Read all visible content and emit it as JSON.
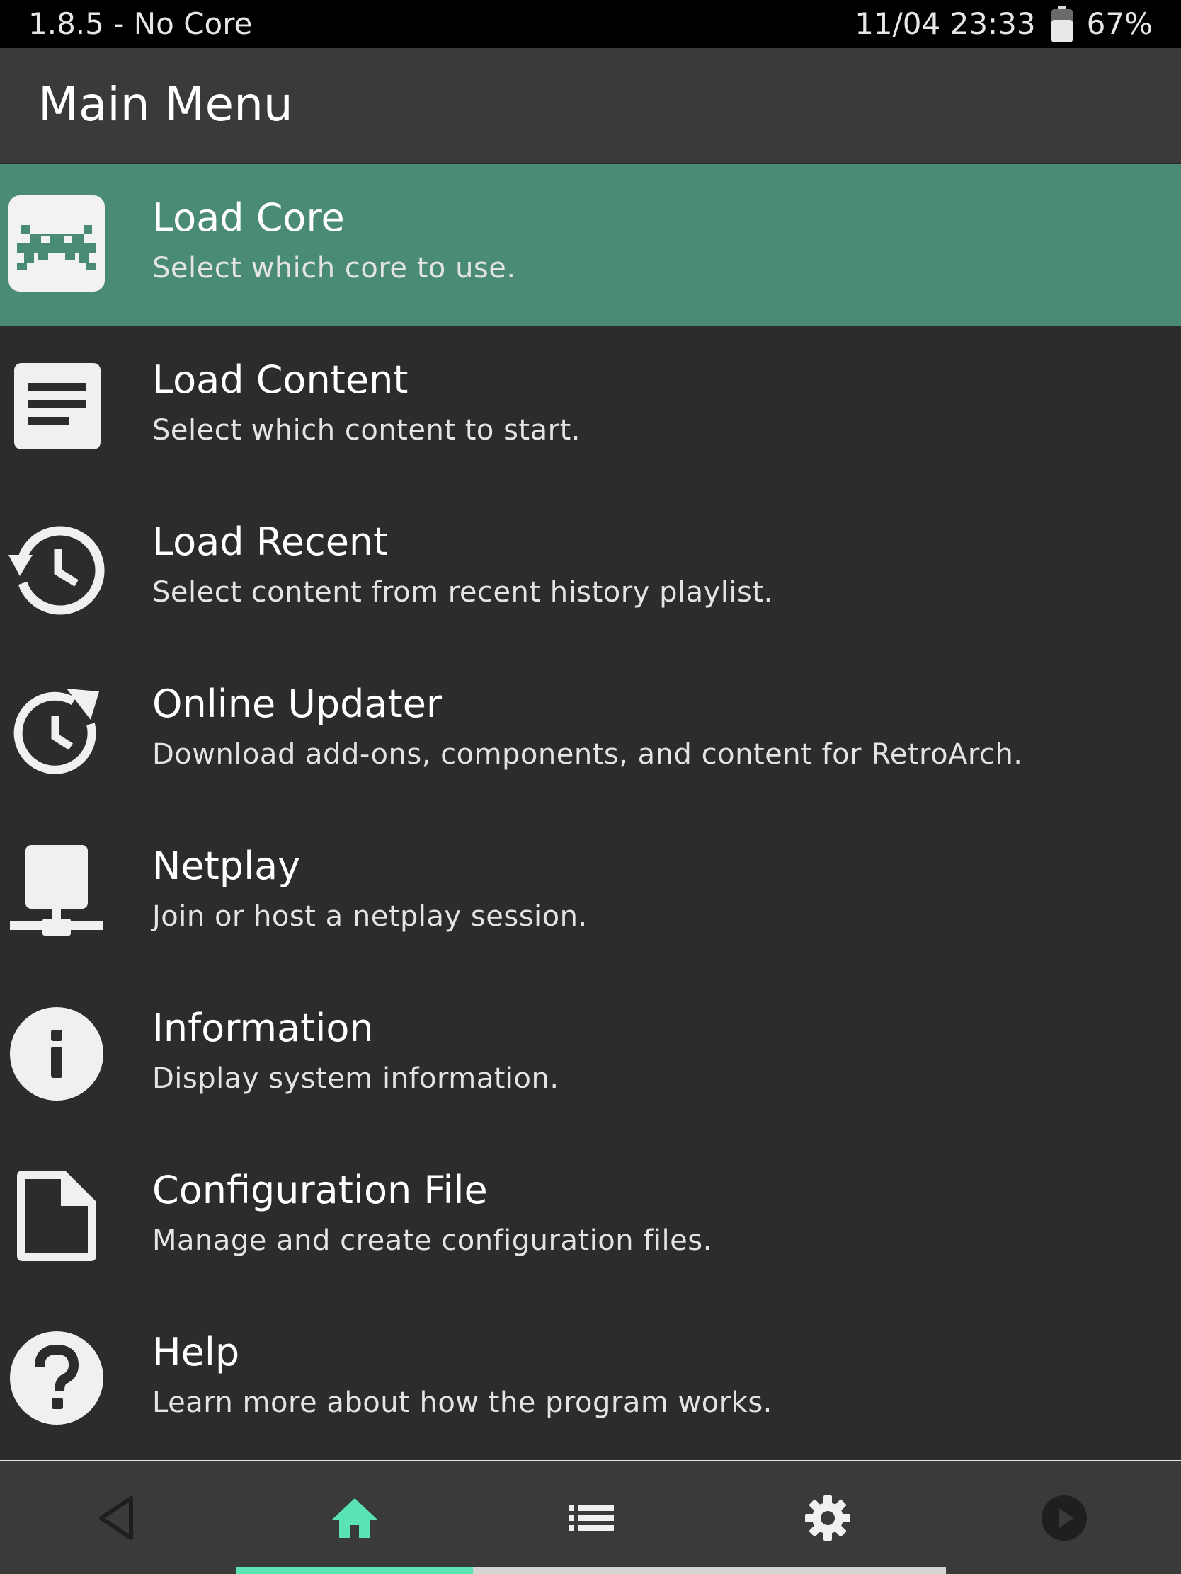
{
  "status_bar": {
    "version_core": "1.8.5 - No Core",
    "datetime": "11/04 23:33",
    "battery_percent": "67%",
    "battery_level": 0.67,
    "battery_icon": "battery-icon"
  },
  "header": {
    "title": "Main Menu"
  },
  "menu": {
    "items": [
      {
        "label": "Load Core",
        "sublabel": "Select which core to use.",
        "icon": "retroarch-invader-icon",
        "selected": true
      },
      {
        "label": "Load Content",
        "sublabel": "Select which content to start.",
        "icon": "document-lines-icon",
        "selected": false
      },
      {
        "label": "Load Recent",
        "sublabel": "Select content from recent history playlist.",
        "icon": "history-icon",
        "selected": false
      },
      {
        "label": "Online Updater",
        "sublabel": "Download add-ons, components, and content for RetroArch.",
        "icon": "update-icon",
        "selected": false
      },
      {
        "label": "Netplay",
        "sublabel": "Join or host a netplay session.",
        "icon": "network-icon",
        "selected": false
      },
      {
        "label": "Information",
        "sublabel": "Display system information.",
        "icon": "info-icon",
        "selected": false
      },
      {
        "label": "Configuration File",
        "sublabel": "Manage and create configuration files.",
        "icon": "file-icon",
        "selected": false
      },
      {
        "label": "Help",
        "sublabel": "Learn more about how the program works.",
        "icon": "help-icon",
        "selected": false
      }
    ]
  },
  "bottom_nav": {
    "tabs": [
      {
        "icon": "back-icon",
        "active": false
      },
      {
        "icon": "home-icon",
        "active": true
      },
      {
        "icon": "playlist-icon",
        "active": false
      },
      {
        "icon": "settings-icon",
        "active": false
      },
      {
        "icon": "resume-icon",
        "active": false
      }
    ],
    "accent_color": "#5ae4b4"
  },
  "colors": {
    "selected_row": "#4a8b78",
    "background": "#2c2c2c",
    "title_bar": "#3a3a3a"
  }
}
